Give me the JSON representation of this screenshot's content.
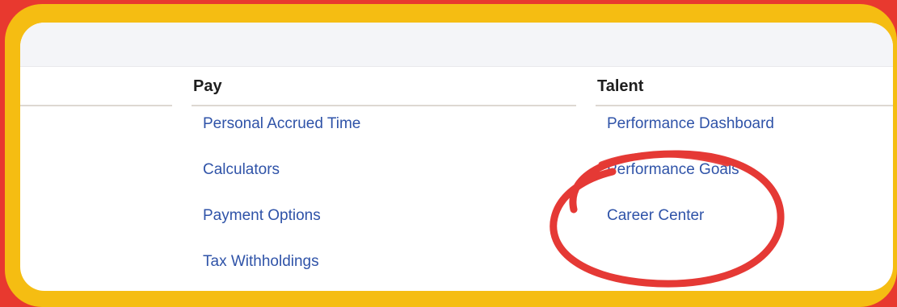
{
  "colors": {
    "background": "#e8392f",
    "frame": "#f5bd12",
    "panel": "#ffffff",
    "link": "#2f53a8",
    "heading": "#1e1e1e",
    "annotation": "#e53935"
  },
  "columns": [
    {
      "title": "",
      "links": []
    },
    {
      "title": "Pay",
      "links": [
        "Personal Accrued Time",
        "Calculators",
        "Payment Options",
        "Tax Withholdings"
      ]
    },
    {
      "title": "Talent",
      "links": [
        "Performance Dashboard",
        "Performance Goals",
        "Career Center"
      ]
    }
  ],
  "annotation": {
    "type": "hand-drawn-circle",
    "target": "Career Center",
    "icon": "circle-highlight"
  }
}
